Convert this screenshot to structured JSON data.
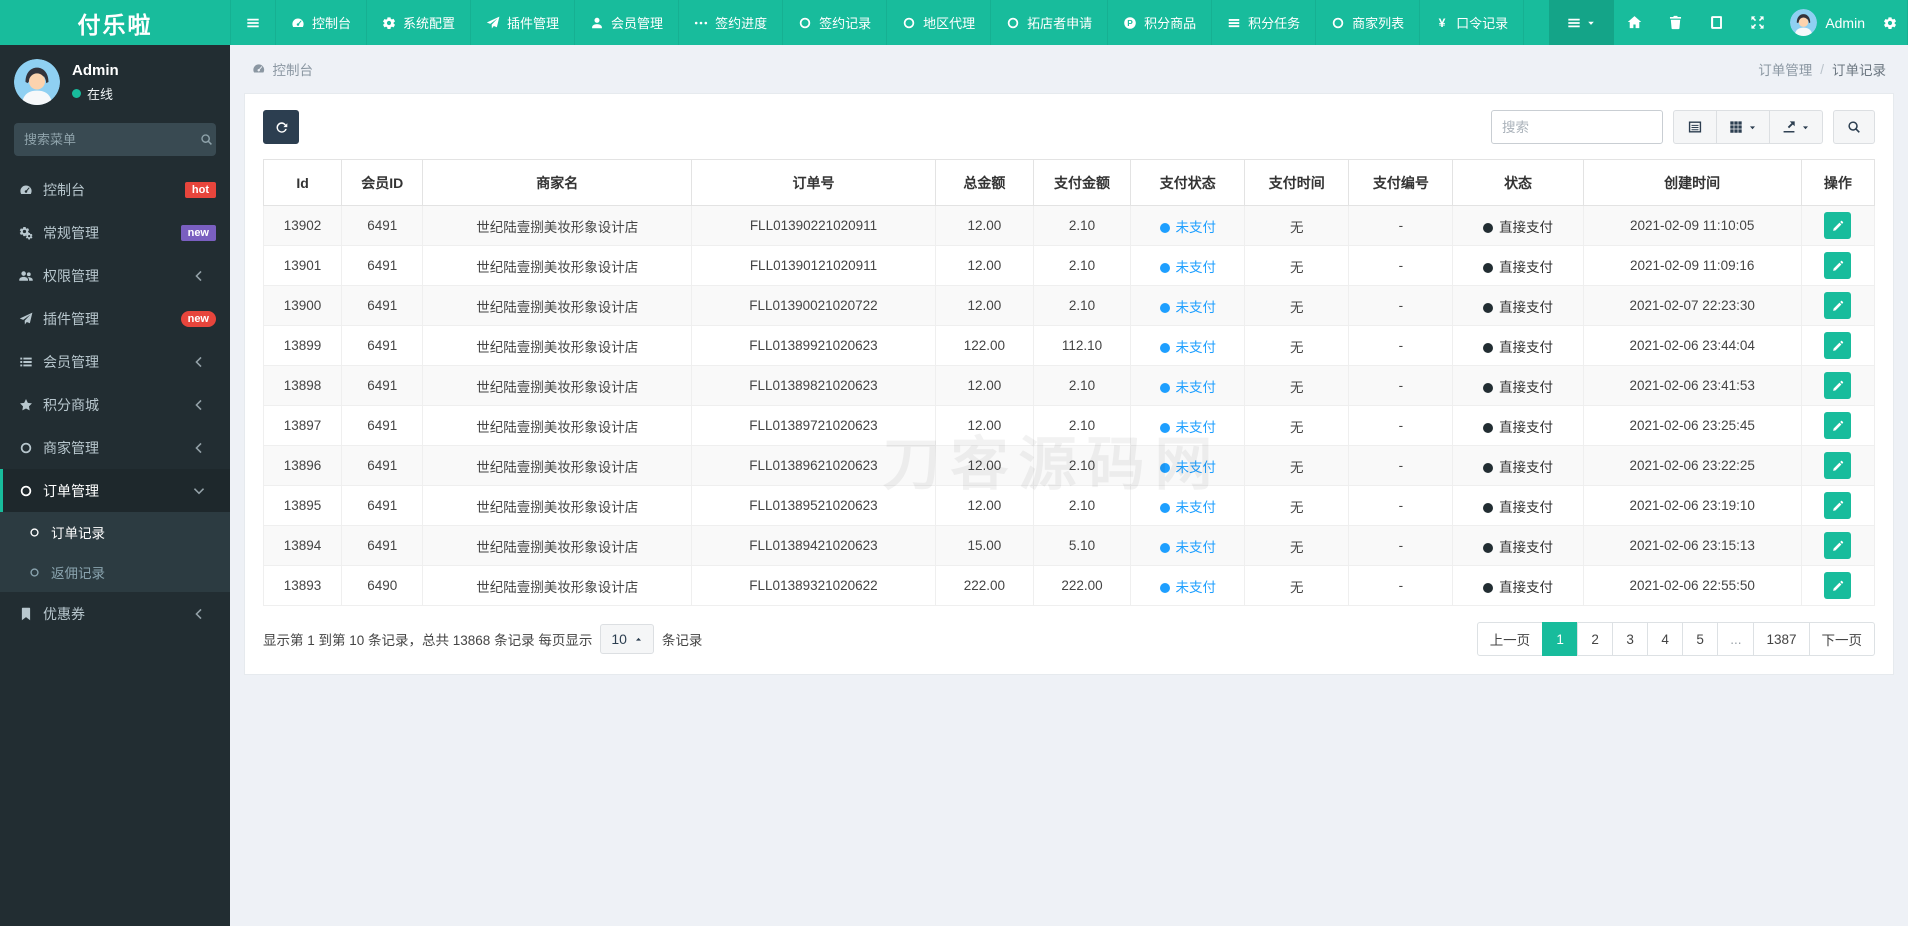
{
  "brand": "付乐啦",
  "colors": {
    "accent": "#18bc9c",
    "dark": "#2c3e50",
    "sidebar_bg": "#222d32",
    "unpaid_blue": "#1e9fff",
    "page_bg": "#eef1f6",
    "badge_hot": "#e7453c",
    "badge_new_purple": "#7a5fc0",
    "badge_new_red": "#e7453c"
  },
  "topnav": {
    "items": [
      {
        "key": "menu-toggle",
        "icon": "bars",
        "label": ""
      },
      {
        "key": "dashboard",
        "icon": "dashboard",
        "label": "控制台"
      },
      {
        "key": "system-config",
        "icon": "gear",
        "label": "系统配置"
      },
      {
        "key": "plugin-manage",
        "icon": "paper-plane",
        "label": "插件管理"
      },
      {
        "key": "member-manage",
        "icon": "user",
        "label": "会员管理"
      },
      {
        "key": "sign-progress",
        "icon": "ellipsis",
        "label": "签约进度"
      },
      {
        "key": "sign-records",
        "icon": "circle-o",
        "label": "签约记录"
      },
      {
        "key": "region-agent",
        "icon": "circle-o",
        "label": "地区代理"
      },
      {
        "key": "store-apply",
        "icon": "circle-o",
        "label": "拓店者申请"
      },
      {
        "key": "points-goods",
        "icon": "p-circle",
        "label": "积分商品"
      },
      {
        "key": "points-tasks",
        "icon": "tasks",
        "label": "积分任务"
      },
      {
        "key": "merchant-list",
        "icon": "circle-o",
        "label": "商家列表"
      },
      {
        "key": "password-records",
        "icon": "yen",
        "label": "口令记录"
      }
    ],
    "right_icons": [
      {
        "key": "home",
        "icon": "home"
      },
      {
        "key": "trash",
        "icon": "trash"
      },
      {
        "key": "log",
        "icon": "log"
      },
      {
        "key": "fullscreen",
        "icon": "expand"
      }
    ],
    "user_name": "Admin"
  },
  "sidebar": {
    "user": {
      "name": "Admin",
      "status": "在线"
    },
    "search_placeholder": "搜索菜单",
    "items": [
      {
        "key": "dashboard",
        "icon": "dashboard",
        "label": "控制台",
        "badge": "hot",
        "badge_color": "#e7453c",
        "badge_pill": false
      },
      {
        "key": "general-manage",
        "icon": "cogs",
        "label": "常规管理",
        "badge": "new",
        "badge_color": "#7a5fc0",
        "badge_pill": false
      },
      {
        "key": "permission-manage",
        "icon": "users",
        "label": "权限管理",
        "chevron": "left"
      },
      {
        "key": "plugin-manage",
        "icon": "paper-plane",
        "label": "插件管理",
        "badge": "new",
        "badge_color": "#e7453c",
        "badge_pill": true
      },
      {
        "key": "member-manage",
        "icon": "list",
        "label": "会员管理",
        "chevron": "left"
      },
      {
        "key": "points-mall",
        "icon": "star",
        "label": "积分商城",
        "chevron": "left"
      },
      {
        "key": "merchant-manage",
        "icon": "circle-o",
        "label": "商家管理",
        "chevron": "left"
      },
      {
        "key": "order-manage",
        "icon": "circle-o",
        "label": "订单管理",
        "chevron": "down",
        "active": true,
        "children": [
          {
            "key": "order-records",
            "label": "订单记录",
            "active": true
          },
          {
            "key": "rebate-records",
            "label": "返佣记录",
            "active": false
          }
        ]
      },
      {
        "key": "coupon",
        "icon": "bookmark",
        "label": "优惠券",
        "chevron": "left"
      }
    ]
  },
  "breadcrumb": {
    "left": "控制台",
    "right": [
      "订单管理",
      "订单记录"
    ],
    "separator": "/"
  },
  "toolbar": {
    "search_placeholder": "搜索",
    "buttons": [
      "detail-view",
      "columns",
      "export",
      "search"
    ]
  },
  "table": {
    "headers": [
      "Id",
      "会员ID",
      "商家名",
      "订单号",
      "总金额",
      "支付金额",
      "支付状态",
      "支付时间",
      "支付编号",
      "状态",
      "创建时间",
      "操作"
    ],
    "rows": [
      {
        "id": "13902",
        "member_id": "6491",
        "merchant": "世纪陆壹捌美妆形象设计店",
        "order_no": "FLL01390221020911",
        "total": "12.00",
        "paid": "2.10",
        "pay_status": "未支付",
        "pay_time": "无",
        "pay_no": "-",
        "status": "直接支付",
        "created": "2021-02-09 11:10:05"
      },
      {
        "id": "13901",
        "member_id": "6491",
        "merchant": "世纪陆壹捌美妆形象设计店",
        "order_no": "FLL01390121020911",
        "total": "12.00",
        "paid": "2.10",
        "pay_status": "未支付",
        "pay_time": "无",
        "pay_no": "-",
        "status": "直接支付",
        "created": "2021-02-09 11:09:16"
      },
      {
        "id": "13900",
        "member_id": "6491",
        "merchant": "世纪陆壹捌美妆形象设计店",
        "order_no": "FLL01390021020722",
        "total": "12.00",
        "paid": "2.10",
        "pay_status": "未支付",
        "pay_time": "无",
        "pay_no": "-",
        "status": "直接支付",
        "created": "2021-02-07 22:23:30"
      },
      {
        "id": "13899",
        "member_id": "6491",
        "merchant": "世纪陆壹捌美妆形象设计店",
        "order_no": "FLL01389921020623",
        "total": "122.00",
        "paid": "112.10",
        "pay_status": "未支付",
        "pay_time": "无",
        "pay_no": "-",
        "status": "直接支付",
        "created": "2021-02-06 23:44:04"
      },
      {
        "id": "13898",
        "member_id": "6491",
        "merchant": "世纪陆壹捌美妆形象设计店",
        "order_no": "FLL01389821020623",
        "total": "12.00",
        "paid": "2.10",
        "pay_status": "未支付",
        "pay_time": "无",
        "pay_no": "-",
        "status": "直接支付",
        "created": "2021-02-06 23:41:53"
      },
      {
        "id": "13897",
        "member_id": "6491",
        "merchant": "世纪陆壹捌美妆形象设计店",
        "order_no": "FLL01389721020623",
        "total": "12.00",
        "paid": "2.10",
        "pay_status": "未支付",
        "pay_time": "无",
        "pay_no": "-",
        "status": "直接支付",
        "created": "2021-02-06 23:25:45"
      },
      {
        "id": "13896",
        "member_id": "6491",
        "merchant": "世纪陆壹捌美妆形象设计店",
        "order_no": "FLL01389621020623",
        "total": "12.00",
        "paid": "2.10",
        "pay_status": "未支付",
        "pay_time": "无",
        "pay_no": "-",
        "status": "直接支付",
        "created": "2021-02-06 23:22:25"
      },
      {
        "id": "13895",
        "member_id": "6491",
        "merchant": "世纪陆壹捌美妆形象设计店",
        "order_no": "FLL01389521020623",
        "total": "12.00",
        "paid": "2.10",
        "pay_status": "未支付",
        "pay_time": "无",
        "pay_no": "-",
        "status": "直接支付",
        "created": "2021-02-06 23:19:10"
      },
      {
        "id": "13894",
        "member_id": "6491",
        "merchant": "世纪陆壹捌美妆形象设计店",
        "order_no": "FLL01389421020623",
        "total": "15.00",
        "paid": "5.10",
        "pay_status": "未支付",
        "pay_time": "无",
        "pay_no": "-",
        "status": "直接支付",
        "created": "2021-02-06 23:15:13"
      },
      {
        "id": "13893",
        "member_id": "6490",
        "merchant": "世纪陆壹捌美妆形象设计店",
        "order_no": "FLL01389321020622",
        "total": "222.00",
        "paid": "222.00",
        "pay_status": "未支付",
        "pay_time": "无",
        "pay_no": "-",
        "status": "直接支付",
        "created": "2021-02-06 22:55:50"
      }
    ]
  },
  "pagination": {
    "summary_prefix": "显示第 1 到第 10 条记录，总共 13868 条记录 每页显示",
    "page_size": "10",
    "summary_suffix": "条记录",
    "prev": "上一页",
    "next": "下一页",
    "pages": [
      "1",
      "2",
      "3",
      "4",
      "5",
      "...",
      "1387"
    ],
    "active_page": "1"
  },
  "watermark": "刀客源码网"
}
